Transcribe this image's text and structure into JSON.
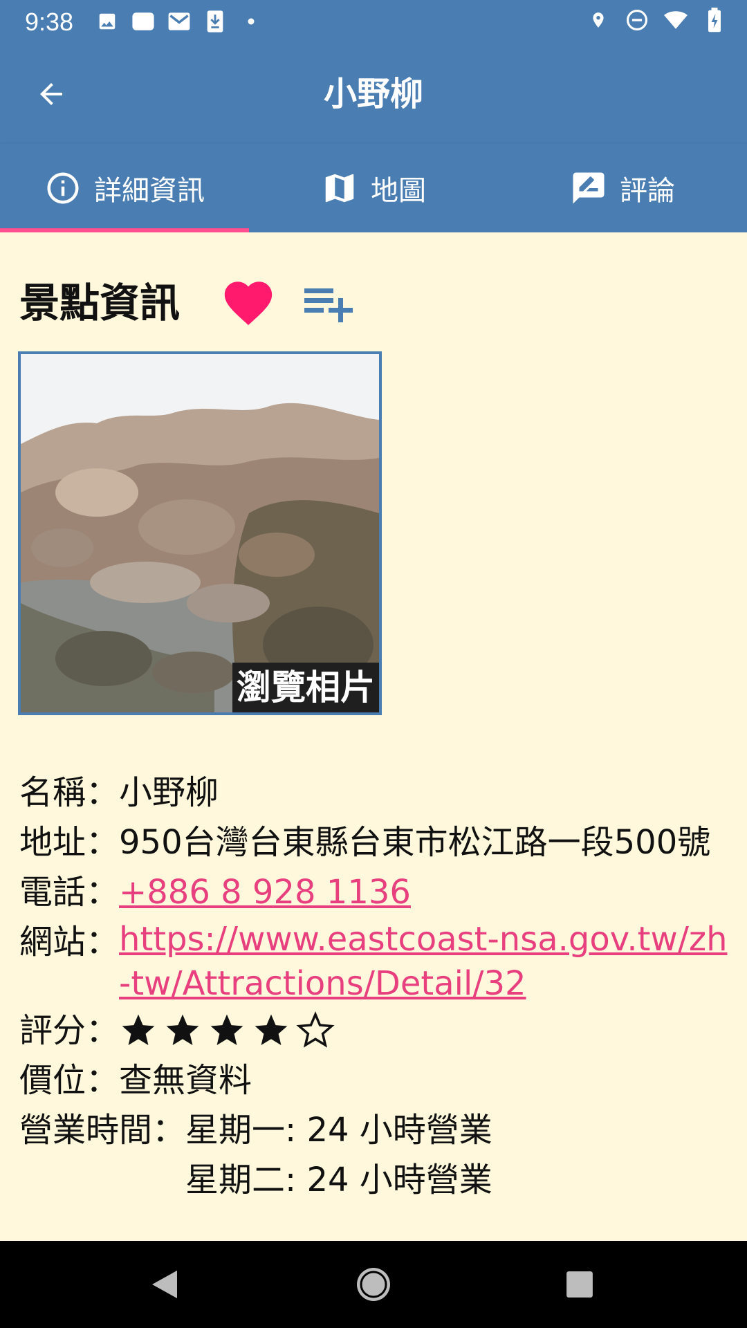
{
  "status_bar": {
    "time": "9:38",
    "left_icons": [
      "image-icon",
      "dropbox-icon",
      "mail-icon",
      "download-icon",
      "dot-icon"
    ],
    "right_icons": [
      "location-icon",
      "do-not-disturb-icon",
      "wifi-icon",
      "battery-charging-icon"
    ]
  },
  "app_bar": {
    "title": "小野柳",
    "back_icon": "arrow-back-icon"
  },
  "tabs": [
    {
      "label": "詳細資訊",
      "icon": "info-icon",
      "selected": true
    },
    {
      "label": "地圖",
      "icon": "map-icon",
      "selected": false
    },
    {
      "label": "評論",
      "icon": "rate-review-icon",
      "selected": false
    }
  ],
  "section": {
    "title": "景點資訊",
    "favorite_icon": "heart-icon",
    "add_to_list_icon": "playlist-add-icon"
  },
  "photo": {
    "caption": "瀏覽相片"
  },
  "info": {
    "name_label": "名稱：",
    "name": "小野柳",
    "address_label": "地址：",
    "address": "950台灣台東縣台東市松江路一段500號",
    "phone_label": "電話：",
    "phone": "+886 8 928 1136",
    "website_label": "網站：",
    "website_line1": "https://www.eastcoast-nsa.gov.tw/zh",
    "website_line2": "-tw/Attractions/Detail/32",
    "rating_label": "評分：",
    "rating": 4,
    "rating_max": 5,
    "price_label": "價位：",
    "price": "查無資料",
    "hours_label": "營業時間：",
    "hours": [
      "星期一: 24 小時營業",
      "星期二: 24 小時營業"
    ]
  },
  "colors": {
    "primary": "#4a7eb3",
    "accent": "#ff4f8f",
    "link": "#e8407e",
    "background": "#fff8dc"
  },
  "nav_bar": {
    "buttons": [
      "back-triangle-icon",
      "home-circle-icon",
      "recents-square-icon"
    ]
  }
}
